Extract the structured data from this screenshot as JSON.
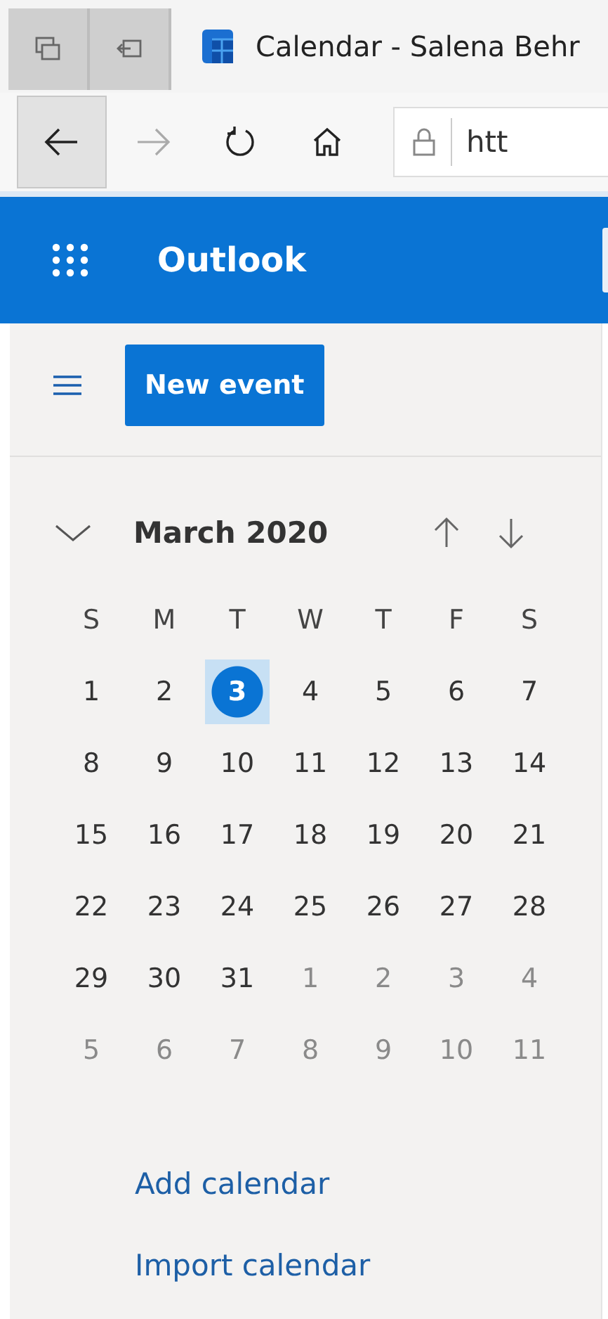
{
  "browser": {
    "tab_title": "Calendar - Salena Behr",
    "address": "htt"
  },
  "header": {
    "app_name": "Outlook"
  },
  "toolbar": {
    "new_event_label": "New event"
  },
  "mini_calendar": {
    "expanded": true,
    "month_title": "March 2020",
    "weekdays": [
      "S",
      "M",
      "T",
      "W",
      "T",
      "F",
      "S"
    ],
    "weeks": [
      [
        {
          "label": "1",
          "selected": false,
          "outside": false
        },
        {
          "label": "2",
          "selected": false,
          "outside": false
        },
        {
          "label": "3",
          "selected": true,
          "outside": false
        },
        {
          "label": "4",
          "selected": false,
          "outside": false
        },
        {
          "label": "5",
          "selected": false,
          "outside": false
        },
        {
          "label": "6",
          "selected": false,
          "outside": false
        },
        {
          "label": "7",
          "selected": false,
          "outside": false
        }
      ],
      [
        {
          "label": "8",
          "selected": false,
          "outside": false
        },
        {
          "label": "9",
          "selected": false,
          "outside": false
        },
        {
          "label": "10",
          "selected": false,
          "outside": false
        },
        {
          "label": "11",
          "selected": false,
          "outside": false
        },
        {
          "label": "12",
          "selected": false,
          "outside": false
        },
        {
          "label": "13",
          "selected": false,
          "outside": false
        },
        {
          "label": "14",
          "selected": false,
          "outside": false
        }
      ],
      [
        {
          "label": "15",
          "selected": false,
          "outside": false
        },
        {
          "label": "16",
          "selected": false,
          "outside": false
        },
        {
          "label": "17",
          "selected": false,
          "outside": false
        },
        {
          "label": "18",
          "selected": false,
          "outside": false
        },
        {
          "label": "19",
          "selected": false,
          "outside": false
        },
        {
          "label": "20",
          "selected": false,
          "outside": false
        },
        {
          "label": "21",
          "selected": false,
          "outside": false
        }
      ],
      [
        {
          "label": "22",
          "selected": false,
          "outside": false
        },
        {
          "label": "23",
          "selected": false,
          "outside": false
        },
        {
          "label": "24",
          "selected": false,
          "outside": false
        },
        {
          "label": "25",
          "selected": false,
          "outside": false
        },
        {
          "label": "26",
          "selected": false,
          "outside": false
        },
        {
          "label": "27",
          "selected": false,
          "outside": false
        },
        {
          "label": "28",
          "selected": false,
          "outside": false
        }
      ],
      [
        {
          "label": "29",
          "selected": false,
          "outside": false
        },
        {
          "label": "30",
          "selected": false,
          "outside": false
        },
        {
          "label": "31",
          "selected": false,
          "outside": false
        },
        {
          "label": "1",
          "selected": false,
          "outside": true
        },
        {
          "label": "2",
          "selected": false,
          "outside": true
        },
        {
          "label": "3",
          "selected": false,
          "outside": true
        },
        {
          "label": "4",
          "selected": false,
          "outside": true
        }
      ],
      [
        {
          "label": "5",
          "selected": false,
          "outside": true
        },
        {
          "label": "6",
          "selected": false,
          "outside": true
        },
        {
          "label": "7",
          "selected": false,
          "outside": true
        },
        {
          "label": "8",
          "selected": false,
          "outside": true
        },
        {
          "label": "9",
          "selected": false,
          "outside": true
        },
        {
          "label": "10",
          "selected": false,
          "outside": true
        },
        {
          "label": "11",
          "selected": false,
          "outside": true
        }
      ]
    ]
  },
  "links": [
    "Add calendar",
    "Import calendar"
  ]
}
